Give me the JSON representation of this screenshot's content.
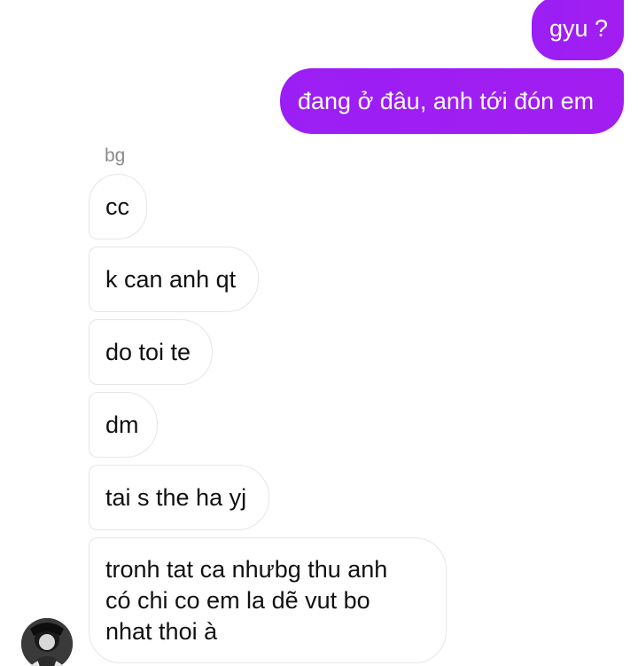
{
  "conversation": {
    "sender_name": "bg",
    "outgoing": [
      {
        "text": "gyu ?"
      },
      {
        "text": "đang ở đâu, anh tới đón em"
      }
    ],
    "incoming": [
      {
        "text": "cc"
      },
      {
        "text": "k can anh qt"
      },
      {
        "text": "do toi te"
      },
      {
        "text": "dm"
      },
      {
        "text": "tai s the ha yj"
      },
      {
        "lines": [
          "tronh tat ca nhưbg thu anh",
          "có chi co em la dẽ vut bo",
          "nhat thoi à"
        ]
      }
    ]
  },
  "colors": {
    "outgoing_bubble": "#a020f0",
    "incoming_border": "#e6e6e6",
    "sender_name": "#8a8a8a"
  },
  "icons": {
    "avatar": "user-avatar-photo"
  }
}
